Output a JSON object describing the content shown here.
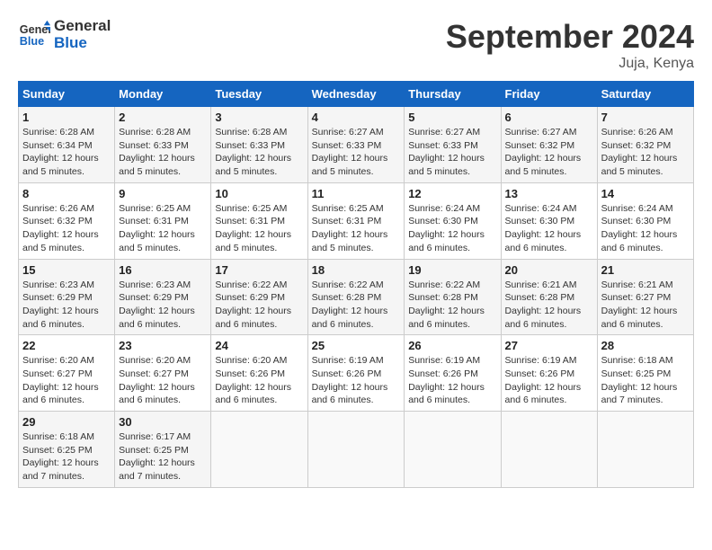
{
  "logo": {
    "line1": "General",
    "line2": "Blue"
  },
  "title": "September 2024",
  "location": "Juja, Kenya",
  "headers": [
    "Sunday",
    "Monday",
    "Tuesday",
    "Wednesday",
    "Thursday",
    "Friday",
    "Saturday"
  ],
  "weeks": [
    [
      {
        "day": "1",
        "sunrise": "6:28 AM",
        "sunset": "6:34 PM",
        "daylight": "12 hours and 5 minutes."
      },
      {
        "day": "2",
        "sunrise": "6:28 AM",
        "sunset": "6:33 PM",
        "daylight": "12 hours and 5 minutes."
      },
      {
        "day": "3",
        "sunrise": "6:28 AM",
        "sunset": "6:33 PM",
        "daylight": "12 hours and 5 minutes."
      },
      {
        "day": "4",
        "sunrise": "6:27 AM",
        "sunset": "6:33 PM",
        "daylight": "12 hours and 5 minutes."
      },
      {
        "day": "5",
        "sunrise": "6:27 AM",
        "sunset": "6:33 PM",
        "daylight": "12 hours and 5 minutes."
      },
      {
        "day": "6",
        "sunrise": "6:27 AM",
        "sunset": "6:32 PM",
        "daylight": "12 hours and 5 minutes."
      },
      {
        "day": "7",
        "sunrise": "6:26 AM",
        "sunset": "6:32 PM",
        "daylight": "12 hours and 5 minutes."
      }
    ],
    [
      {
        "day": "8",
        "sunrise": "6:26 AM",
        "sunset": "6:32 PM",
        "daylight": "12 hours and 5 minutes."
      },
      {
        "day": "9",
        "sunrise": "6:25 AM",
        "sunset": "6:31 PM",
        "daylight": "12 hours and 5 minutes."
      },
      {
        "day": "10",
        "sunrise": "6:25 AM",
        "sunset": "6:31 PM",
        "daylight": "12 hours and 5 minutes."
      },
      {
        "day": "11",
        "sunrise": "6:25 AM",
        "sunset": "6:31 PM",
        "daylight": "12 hours and 5 minutes."
      },
      {
        "day": "12",
        "sunrise": "6:24 AM",
        "sunset": "6:30 PM",
        "daylight": "12 hours and 6 minutes."
      },
      {
        "day": "13",
        "sunrise": "6:24 AM",
        "sunset": "6:30 PM",
        "daylight": "12 hours and 6 minutes."
      },
      {
        "day": "14",
        "sunrise": "6:24 AM",
        "sunset": "6:30 PM",
        "daylight": "12 hours and 6 minutes."
      }
    ],
    [
      {
        "day": "15",
        "sunrise": "6:23 AM",
        "sunset": "6:29 PM",
        "daylight": "12 hours and 6 minutes."
      },
      {
        "day": "16",
        "sunrise": "6:23 AM",
        "sunset": "6:29 PM",
        "daylight": "12 hours and 6 minutes."
      },
      {
        "day": "17",
        "sunrise": "6:22 AM",
        "sunset": "6:29 PM",
        "daylight": "12 hours and 6 minutes."
      },
      {
        "day": "18",
        "sunrise": "6:22 AM",
        "sunset": "6:28 PM",
        "daylight": "12 hours and 6 minutes."
      },
      {
        "day": "19",
        "sunrise": "6:22 AM",
        "sunset": "6:28 PM",
        "daylight": "12 hours and 6 minutes."
      },
      {
        "day": "20",
        "sunrise": "6:21 AM",
        "sunset": "6:28 PM",
        "daylight": "12 hours and 6 minutes."
      },
      {
        "day": "21",
        "sunrise": "6:21 AM",
        "sunset": "6:27 PM",
        "daylight": "12 hours and 6 minutes."
      }
    ],
    [
      {
        "day": "22",
        "sunrise": "6:20 AM",
        "sunset": "6:27 PM",
        "daylight": "12 hours and 6 minutes."
      },
      {
        "day": "23",
        "sunrise": "6:20 AM",
        "sunset": "6:27 PM",
        "daylight": "12 hours and 6 minutes."
      },
      {
        "day": "24",
        "sunrise": "6:20 AM",
        "sunset": "6:26 PM",
        "daylight": "12 hours and 6 minutes."
      },
      {
        "day": "25",
        "sunrise": "6:19 AM",
        "sunset": "6:26 PM",
        "daylight": "12 hours and 6 minutes."
      },
      {
        "day": "26",
        "sunrise": "6:19 AM",
        "sunset": "6:26 PM",
        "daylight": "12 hours and 6 minutes."
      },
      {
        "day": "27",
        "sunrise": "6:19 AM",
        "sunset": "6:26 PM",
        "daylight": "12 hours and 6 minutes."
      },
      {
        "day": "28",
        "sunrise": "6:18 AM",
        "sunset": "6:25 PM",
        "daylight": "12 hours and 7 minutes."
      }
    ],
    [
      {
        "day": "29",
        "sunrise": "6:18 AM",
        "sunset": "6:25 PM",
        "daylight": "12 hours and 7 minutes."
      },
      {
        "day": "30",
        "sunrise": "6:17 AM",
        "sunset": "6:25 PM",
        "daylight": "12 hours and 7 minutes."
      },
      null,
      null,
      null,
      null,
      null
    ]
  ],
  "labels": {
    "sunrise": "Sunrise:",
    "sunset": "Sunset:",
    "daylight": "Daylight:"
  }
}
